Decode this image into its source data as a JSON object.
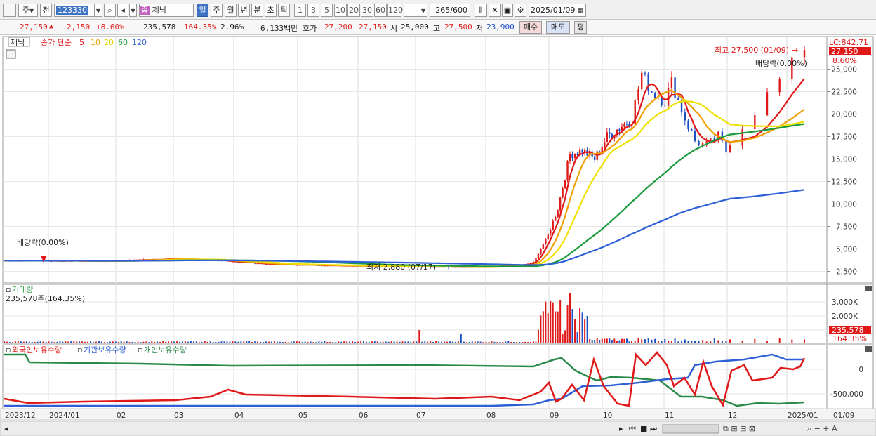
{
  "toolbar": {
    "period_prefix": "주",
    "prev_label": "전",
    "code": "123330",
    "name_badge": "종",
    "name": "제닉",
    "periods": [
      "일",
      "주",
      "월",
      "년",
      "분",
      "초",
      "틱"
    ],
    "selected_period": "일",
    "intervals": [
      "1",
      "3",
      "5",
      "10",
      "20",
      "30",
      "60",
      "120"
    ],
    "count": "265",
    "count_total": "/600",
    "date": "2025/01/09"
  },
  "quote": {
    "price": "27,150",
    "change_arrow": "▲",
    "change": "2,150",
    "change_pct": "+8.60%",
    "volume": "235,578",
    "volume_ratio": "164.35%",
    "turnover": "2.96%",
    "amount": "6,133백만",
    "hoga_label": "호가",
    "ask": "27,200",
    "bid": "27,150",
    "open_label": "시",
    "open": "25,000",
    "high_label": "고",
    "high": "27,500",
    "low_label": "저",
    "low": "23,900",
    "buy_button": "매수",
    "sell_button": "매도",
    "eval_button": "평"
  },
  "price_panel": {
    "name_tag": "제닉",
    "ma_title": "종가 단순",
    "ma_periods": [
      "5",
      "10",
      "20",
      "60",
      "120"
    ],
    "ma_colors": [
      "#e01818",
      "#f0a000",
      "#f0e000",
      "#1a9a3a",
      "#2e5fd6"
    ],
    "lc_label": "LC:842.71",
    "current_tag": "27,150",
    "change_pct_tag": "8.60%",
    "high_annotation": "최고 27,500 (01/09)",
    "low_annotation": "최저 2,880 (07/17)",
    "dividend_left": "배당락(0.00%)",
    "dividend_right": "배당락(0.00%)",
    "y_ticks": [
      "25,000",
      "22,500",
      "20,000",
      "17,500",
      "15,000",
      "12,500",
      "10,000",
      "7,500",
      "5,000",
      "2,500"
    ]
  },
  "volume_panel": {
    "title": "거래량",
    "summary": "235,578주(164.35%)",
    "y_ticks": [
      "3,000K",
      "2,000K",
      "1,000K"
    ],
    "current_tag": "235,578",
    "ratio_tag": "164.35%"
  },
  "holding_panel": {
    "series": [
      "외국인보유수량",
      "기관보유수량",
      "개인보유수량"
    ],
    "series_colors": [
      "#e01818",
      "#2e5fd6",
      "#2a8a4a"
    ],
    "y_ticks": [
      "0",
      "-500,000"
    ]
  },
  "x_axis": [
    "2023/12",
    "2024/01",
    "02",
    "03",
    "04",
    "05",
    "06",
    "07",
    "08",
    "09",
    "10",
    "11",
    "12",
    "2025/01",
    "01/09"
  ],
  "chart_data": [
    {
      "type": "line",
      "title": "종가 단순",
      "x": [
        "2023/12",
        "2024/01",
        "02",
        "03",
        "04",
        "05",
        "06",
        "07",
        "08",
        "09",
        "10",
        "11",
        "12",
        "2025/01"
      ],
      "series": [
        {
          "name": "5",
          "values": [
            3800,
            3700,
            3600,
            3800,
            3400,
            3200,
            3100,
            3000,
            3200,
            12000,
            19000,
            21000,
            17000,
            26500
          ]
        },
        {
          "name": "10",
          "values": [
            3800,
            3700,
            3600,
            3750,
            3400,
            3200,
            3100,
            3000,
            3200,
            9000,
            17000,
            22500,
            16500,
            25000
          ]
        },
        {
          "name": "20",
          "values": [
            3800,
            3700,
            3600,
            3700,
            3400,
            3250,
            3150,
            3050,
            3200,
            6000,
            14000,
            22000,
            17000,
            22000
          ]
        },
        {
          "name": "60",
          "values": [
            3700,
            3700,
            3650,
            3650,
            3500,
            3300,
            3200,
            3150,
            3250,
            4500,
            9000,
            15500,
            17800,
            20200
          ]
        },
        {
          "name": "120",
          "values": [
            3600,
            3650,
            3650,
            3600,
            3500,
            3400,
            3300,
            3200,
            3250,
            3500,
            6000,
            9000,
            11500,
            14300
          ]
        }
      ],
      "ylim": [
        1500,
        27500
      ]
    }
  ]
}
